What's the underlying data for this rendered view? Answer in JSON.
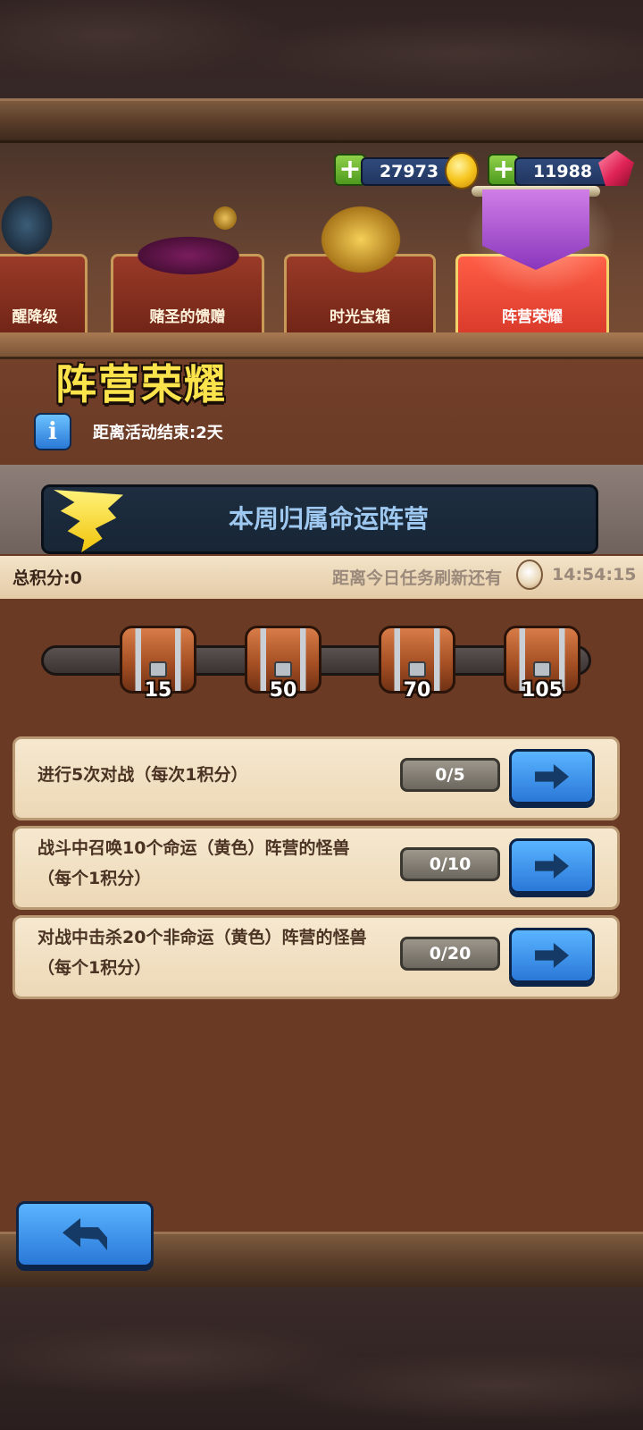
{
  "currency": {
    "gold": "27973",
    "gems": "11988"
  },
  "tabs": [
    {
      "label": "醒降级"
    },
    {
      "label": "赌圣的馈赠"
    },
    {
      "label": "时光宝箱"
    },
    {
      "label": "阵营荣耀"
    }
  ],
  "event": {
    "title": "阵营荣耀",
    "end_text": "距离活动结束:2天",
    "banner_text": "本周归属命运阵营",
    "info_icon": "i"
  },
  "score": {
    "total": "总积分:0",
    "refresh_label": "距离今日任务刷新还有",
    "timer": "14:54:15"
  },
  "milestones": [
    "15",
    "50",
    "70",
    "105"
  ],
  "tasks": [
    {
      "text": "进行5次对战（每次1积分）",
      "progress": "0/5"
    },
    {
      "text": "战斗中召唤10个命运（黄色）阵营的怪兽（每个1积分）",
      "progress": "0/10"
    },
    {
      "text": "对战中击杀20个非命运（黄色）阵营的怪兽（每个1积分）",
      "progress": "0/20"
    }
  ],
  "icons": {
    "plus": "+",
    "coin": "gold-coin-icon",
    "gem": "ruby-gem-icon",
    "clock": "clock-icon",
    "arrow": "arrow-right-icon",
    "back": "back-arrow-icon"
  }
}
